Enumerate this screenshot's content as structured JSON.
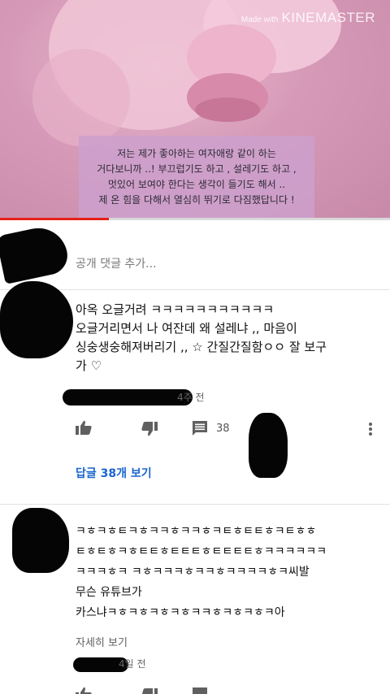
{
  "video": {
    "watermark_small": "Made with",
    "watermark_big": "KINEMASTER",
    "caption_lines": [
      "저는 제가 좋아하는 여자애랑 같이 하는",
      "거다보니까 ..! 부끄럽기도 하고 , 설레기도 하고 ,",
      "멋있어 보여야 한다는 생각이 들기도 해서 ..",
      "제 온 힘을 다해서 열심히 뛰기로 다짐했답니다 !"
    ],
    "progress_fraction": 0.28
  },
  "add_comment": {
    "placeholder": "공개 댓글 추가..."
  },
  "comments": [
    {
      "lines": [
        "아옥 오글거려 ㅋㅋㅋㅋㅋㅋㅋㅋㅋㅋㅋ",
        "오글거리면서 나 여잔데 왜 설레냐 ,,   마음이",
        "싱숭생숭해져버리기 ,, ☆ 간질간질함ㅇㅇ   잘 보구",
        "가 ♡"
      ],
      "time": "4주 전",
      "dislike_count": "38",
      "replies_label": "답글 38개 보기"
    },
    {
      "lines": [
        "ㅋㅎㅋㅎㅌㅋㅎㅋㅋㅎㅋㅋㅎㅋㅌㅎㅌㅌㅎㅋㅌㅎㅎ",
        "ㅌㅎㅌㅎㅋㅎㅌㅌㅎㅌㅌㅌㅎㅌㅌㅌㅌㅎㅋㅋㅋㅋㅋㅋ",
        "ㅋㅋㅋㅎㅋ ㅋㅎㅋㅋㅋㅎㅋㅋㅎㅋㅋㅋㅋㅎㅋ씨발",
        "무슨 유튜브가",
        "카스냐ㅋㅎㅋㅎㅋㅎㅋㅎㅋㅋㅎㅋㅎㅋㅎㅋ아"
      ],
      "read_more": "자세히 보기",
      "time": "4일 전"
    }
  ]
}
